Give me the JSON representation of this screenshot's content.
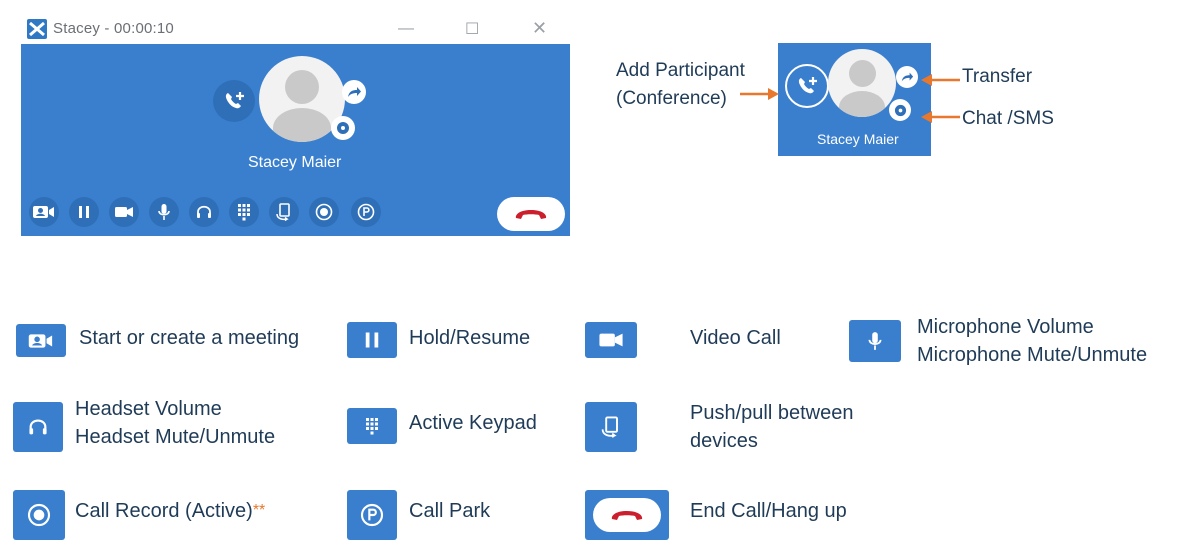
{
  "window": {
    "title": "Stacey - 00:00:10",
    "minimize_glyph": "—",
    "maximize_glyph": "☐",
    "close_glyph": "✕"
  },
  "call": {
    "contact_name": "Stacey Maier"
  },
  "callout": {
    "contact_name": "Stacey Maier",
    "add_participant_line1": "Add Participant",
    "add_participant_line2": "(Conference)",
    "transfer": "Transfer",
    "chat": "Chat /SMS"
  },
  "legend": {
    "meeting": "Start or create a meeting",
    "hold": "Hold/Resume",
    "video": "Video Call",
    "mic_line1": "Microphone Volume",
    "mic_line2": "Microphone Mute/Unmute",
    "headset_line1": "Headset Volume",
    "headset_line2": "Headset Mute/Unmute",
    "keypad": "Active Keypad",
    "push_line1": "Push/pull between",
    "push_line2": "devices",
    "record": "Call Record (Active)",
    "record_mark": "**",
    "park": "Call Park",
    "endcall": "End Call/Hang up"
  },
  "colors": {
    "panel_blue": "#3a7fcd",
    "button_blue": "#2f6fb8",
    "text_navy": "#1f3b57",
    "arrow_orange": "#e8782d",
    "hangup_red": "#cc1f2d"
  }
}
